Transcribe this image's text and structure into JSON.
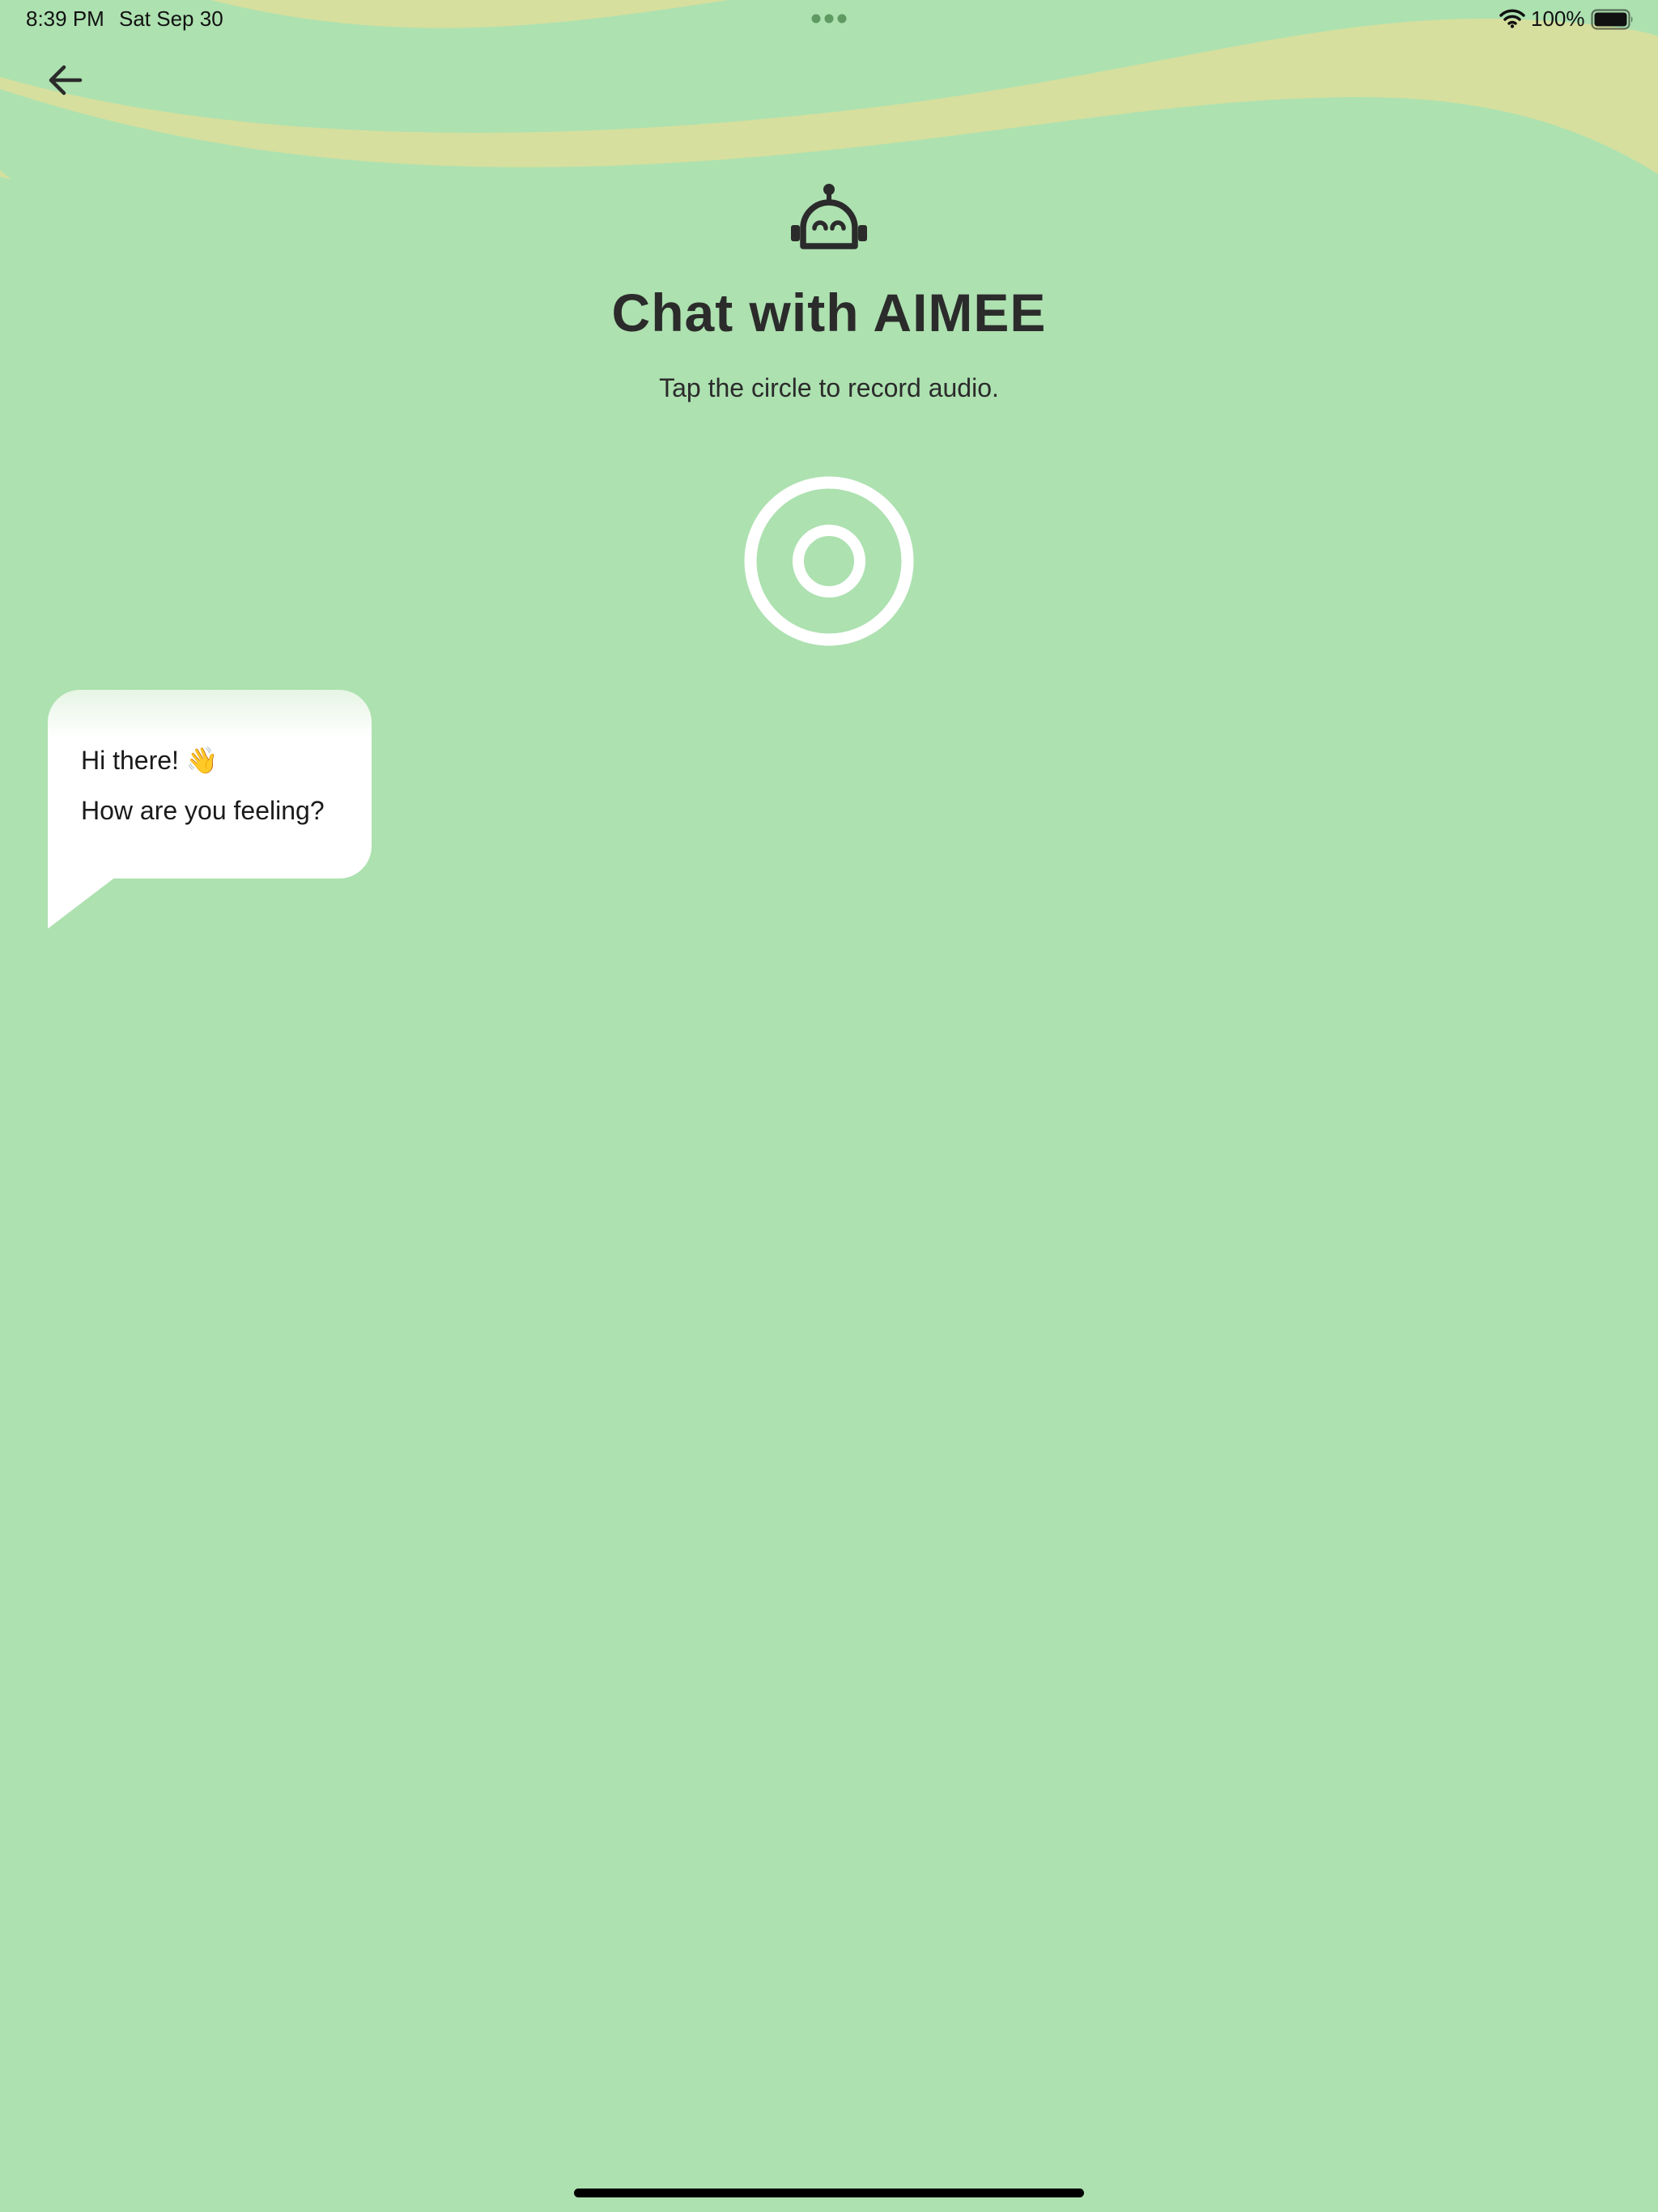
{
  "status_bar": {
    "time": "8:39 PM",
    "date": "Sat Sep 30",
    "battery": "100%",
    "icons": [
      "multitasking-dots-icon",
      "wifi-icon",
      "battery-icon"
    ]
  },
  "nav": {
    "back_icon": "arrow-left-icon"
  },
  "header": {
    "icon": "robot-icon",
    "title": "Chat with AIMEE",
    "subtitle": "Tap the circle to record audio."
  },
  "record": {
    "icon": "record-circle-icon"
  },
  "chat": {
    "messages": [
      {
        "text": "Hi there! 👋"
      },
      {
        "text": "How are you feeling?"
      }
    ]
  },
  "colors": {
    "background": "#ade1b0",
    "wave": "#d6df9e",
    "text": "#2b2b2b",
    "bubble": "#ffffff",
    "record": "#ffffff"
  }
}
